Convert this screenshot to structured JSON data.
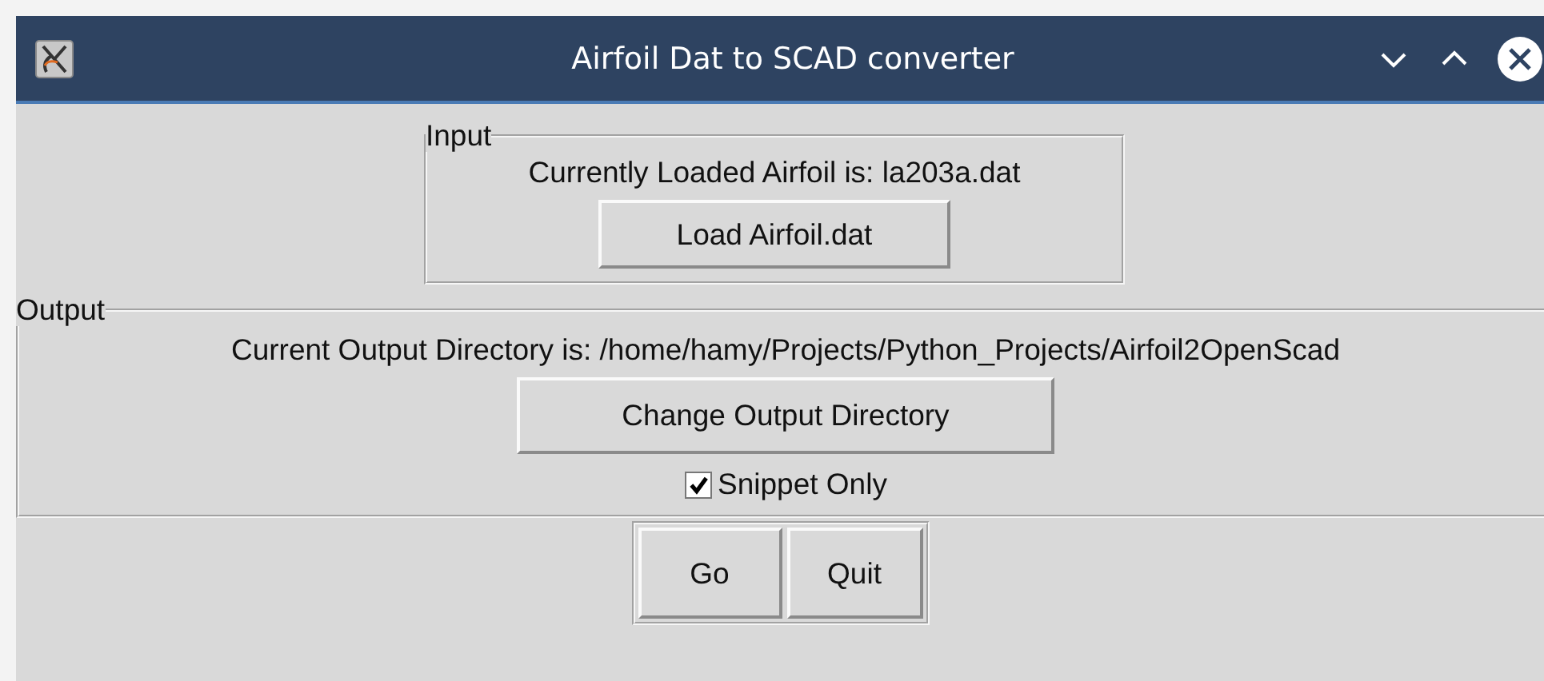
{
  "window": {
    "title": "Airfoil Dat to SCAD converter"
  },
  "input": {
    "legend": "Input",
    "label": "Currently Loaded Airfoil is: la203a.dat",
    "button": "Load Airfoil.dat"
  },
  "output": {
    "legend": "Output",
    "label": "Current Output Directory is: /home/hamy/Projects/Python_Projects/Airfoil2OpenScad",
    "button": "Change Output Directory",
    "checkbox": {
      "label": "Snippet Only",
      "checked": true
    }
  },
  "buttons": [
    "Go",
    "Quit"
  ]
}
